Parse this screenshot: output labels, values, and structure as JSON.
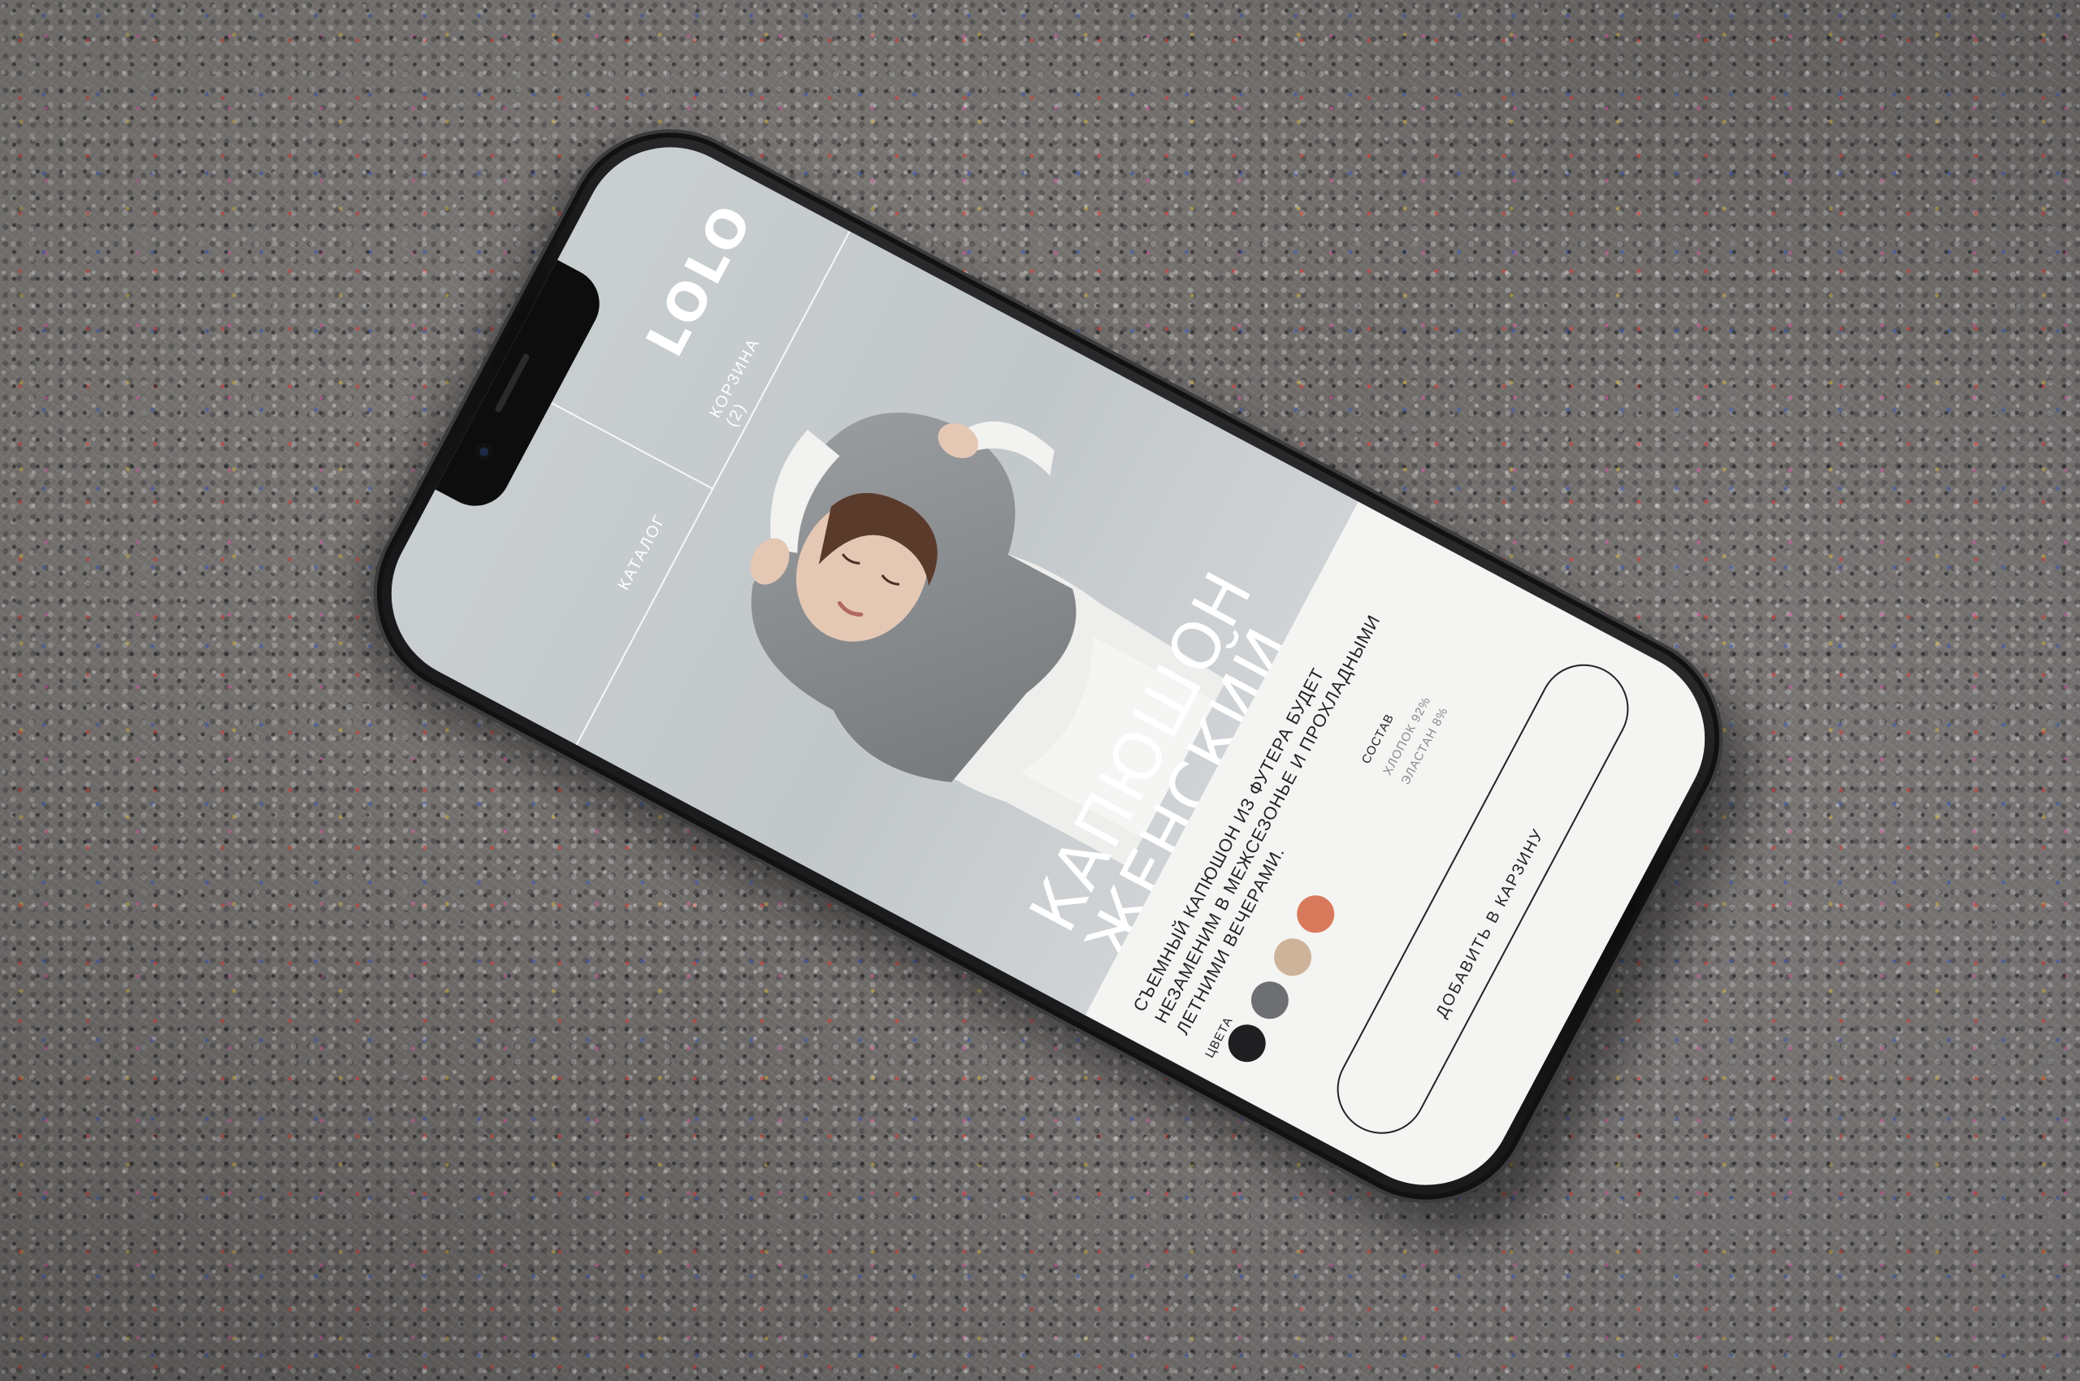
{
  "app": {
    "logo": "LOLO"
  },
  "nav": {
    "catalog_label": "КАТАЛОГ",
    "cart_label": "КОРЗИНА (2)"
  },
  "product": {
    "title_line1": "КАПЮШОН",
    "title_line2": "ЖЕНСКИЙ",
    "description": "СЪЕМНЫЙ КАПЮШОН ИЗ ФУТЕРА БУДЕТ НЕЗАМЕНИМ В МЕЖСЕЗОНЬЕ И ПРОХЛАДНЫМИ ЛЕТНИМИ ВЕЧЕРАМИ.",
    "colors_label": "ЦВЕТА",
    "colors": [
      {
        "name": "black",
        "hex": "#1f1f21"
      },
      {
        "name": "gray",
        "hex": "#6e6f72"
      },
      {
        "name": "beige",
        "hex": "#cdb39a"
      },
      {
        "name": "terracotta",
        "hex": "#d9795b"
      }
    ],
    "composition_label": "СОСТАВ",
    "composition": [
      "ХЛОПОК 92%",
      "ЭЛАСТАН 8%"
    ],
    "add_to_cart_label": "ДОБАВИТЬ В КАРЗИНУ"
  },
  "theme": {
    "accent": "#222222",
    "hero_bg": "#c4c9cc",
    "panel_bg": "#f4f4f2"
  }
}
